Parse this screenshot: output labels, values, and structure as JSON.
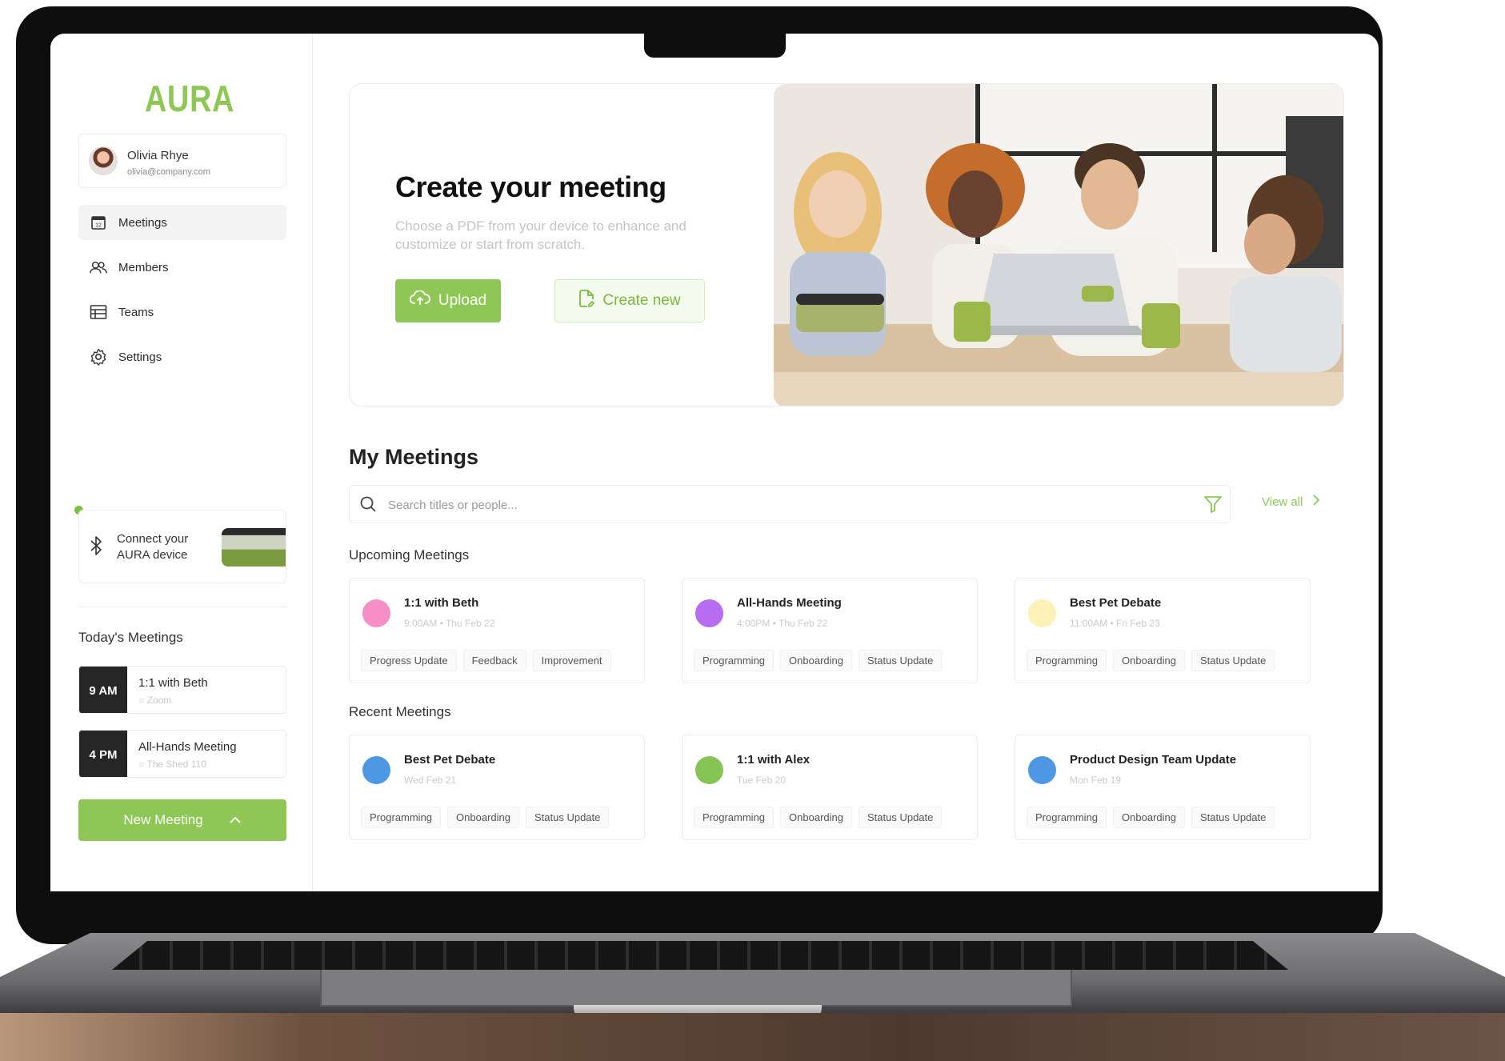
{
  "app": {
    "logo": "AURA",
    "brand_color": "#8ec756"
  },
  "user": {
    "name": "Olivia Rhye",
    "email": "olivia@company.com"
  },
  "nav": [
    {
      "label": "Meetings",
      "icon": "calendar-icon",
      "active": true
    },
    {
      "label": "Members",
      "icon": "members-icon",
      "active": false
    },
    {
      "label": "Teams",
      "icon": "table-icon",
      "active": false
    },
    {
      "label": "Settings",
      "icon": "gear-icon",
      "active": false
    }
  ],
  "device": {
    "label_line1": "Connect your",
    "label_line2": "AURA device",
    "status_color": "#7bc043"
  },
  "today": {
    "title": "Today's Meetings",
    "items": [
      {
        "time": "9 AM",
        "name": "1:1 with Beth",
        "location": "Zoom"
      },
      {
        "time": "4 PM",
        "name": "All-Hands Meeting",
        "location": "The Shed 110"
      }
    ]
  },
  "new_meeting_label": "New Meeting",
  "hero": {
    "title": "Create your meeting",
    "subtitle": "Choose a PDF from your device to enhance and customize or start from scratch.",
    "upload_label": "Upload",
    "create_label": "Create new"
  },
  "my_meetings": {
    "title": "My Meetings",
    "search_placeholder": "Search titles or people...",
    "view_all_label": "View all",
    "upcoming_title": "Upcoming Meetings",
    "recent_title": "Recent Meetings",
    "upcoming": [
      {
        "title": "1:1 with Beth",
        "time": "9:00AM • Thu Feb 22",
        "color": "#f58fc6",
        "tags": [
          "Progress Update",
          "Feedback",
          "Improvement"
        ]
      },
      {
        "title": "All-Hands Meeting",
        "time": "4:00PM • Thu Feb 22",
        "color": "#b86cf2",
        "tags": [
          "Programming",
          "Onboarding",
          "Status Update"
        ]
      },
      {
        "title": "Best Pet Debate",
        "time": "11:00AM • Fri Feb 23",
        "color": "#fdf2b5",
        "tags": [
          "Programming",
          "Onboarding",
          "Status Update"
        ]
      }
    ],
    "recent": [
      {
        "title": "Best Pet Debate",
        "time": "Wed Feb 21",
        "color": "#4d97e3",
        "tags": [
          "Programming",
          "Onboarding",
          "Status Update"
        ]
      },
      {
        "title": "1:1 with Alex",
        "time": "Tue Feb 20",
        "color": "#86c455",
        "tags": [
          "Programming",
          "Onboarding",
          "Status Update"
        ]
      },
      {
        "title": "Product Design Team Update",
        "time": "Mon Feb 19",
        "color": "#4d97e3",
        "tags": [
          "Programming",
          "Onboarding",
          "Status Update"
        ]
      }
    ]
  }
}
